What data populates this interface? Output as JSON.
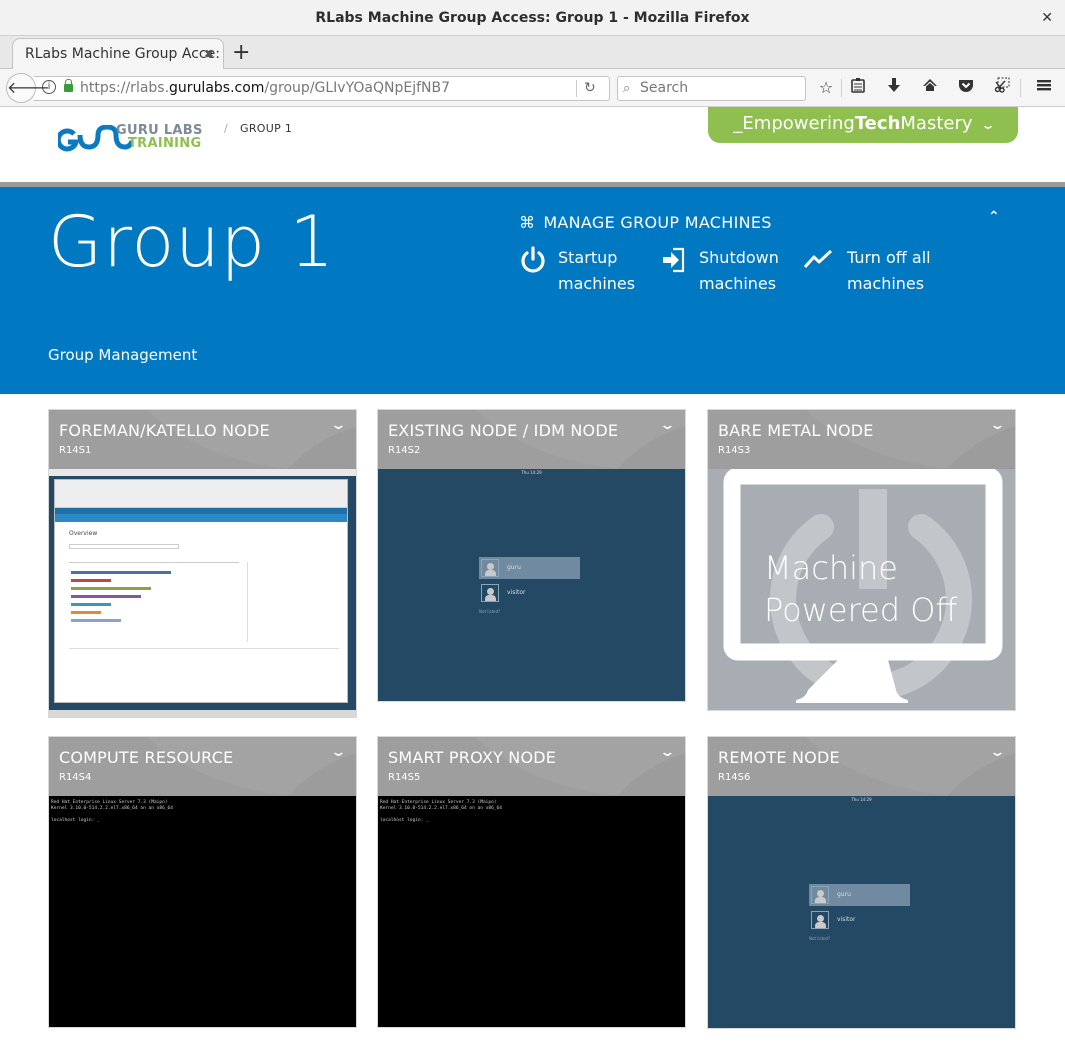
{
  "window": {
    "title": "RLabs Machine Group Access: Group 1 - Mozilla Firefox",
    "close_icon": "close-icon"
  },
  "browser": {
    "tab_label": "RLabs Machine Group Acce:",
    "new_tab_label": "+",
    "url_prefix": "https://rlabs.",
    "url_domain": "gurulabs.com",
    "url_path": "/group/GLIvYOaQNpEjfNB7",
    "search_placeholder": "Search",
    "toolbar_icons": [
      "star-icon",
      "reading-list-icon",
      "download-icon",
      "home-icon",
      "pocket-icon",
      "screenshot-icon",
      "menu-icon"
    ]
  },
  "header": {
    "logo_top": "GURU LABS",
    "logo_bottom": "TRAINING",
    "breadcrumb_sep": "/",
    "breadcrumb_current": "GROUP 1",
    "tagline_pre": "_Empowering",
    "tagline_bold": "Tech",
    "tagline_post": "Mastery",
    "colors": {
      "blue": "#0078c2",
      "green": "#8fbf4e"
    }
  },
  "hero": {
    "title": "Group 1",
    "subtitle": "Group Management",
    "manage_label": "MANAGE GROUP MACHINES",
    "actions": [
      {
        "line1": "Startup",
        "line2": "machines",
        "icon": "power-icon"
      },
      {
        "line1": "Shutdown",
        "line2": "machines",
        "icon": "sign-in-icon"
      },
      {
        "line1": "Turn off all",
        "line2": "machines",
        "icon": "pulse-icon"
      }
    ]
  },
  "machines": [
    {
      "name": "FOREMAN/KATELLO NODE",
      "code": "R14S1",
      "screen": "desktop-browser"
    },
    {
      "name": "EXISTING NODE / IDM NODE",
      "code": "R14S2",
      "screen": "gnome-login"
    },
    {
      "name": "BARE METAL NODE",
      "code": "R14S3",
      "screen": "powered-off",
      "status_line1": "Machine",
      "status_line2": "Powered Off"
    },
    {
      "name": "COMPUTE RESOURCE",
      "code": "R14S4",
      "screen": "console"
    },
    {
      "name": "SMART PROXY NODE",
      "code": "R14S5",
      "screen": "console"
    },
    {
      "name": "REMOTE NODE",
      "code": "R14S6",
      "screen": "gnome-login"
    }
  ],
  "console": {
    "line1": "Red Hat Enterprise Linux Server 7.3 (Maipo)",
    "line2": "Kernel 3.10.0-514.2.2.el7.x86_64 on an x86_64",
    "line3": "localhost login: _"
  },
  "gnome": {
    "clock": "Thu 14:29",
    "users": [
      "guru",
      "visitor"
    ],
    "not_listed": "Not listed?"
  },
  "foreman_thumb": {
    "page_title": "Overview"
  }
}
